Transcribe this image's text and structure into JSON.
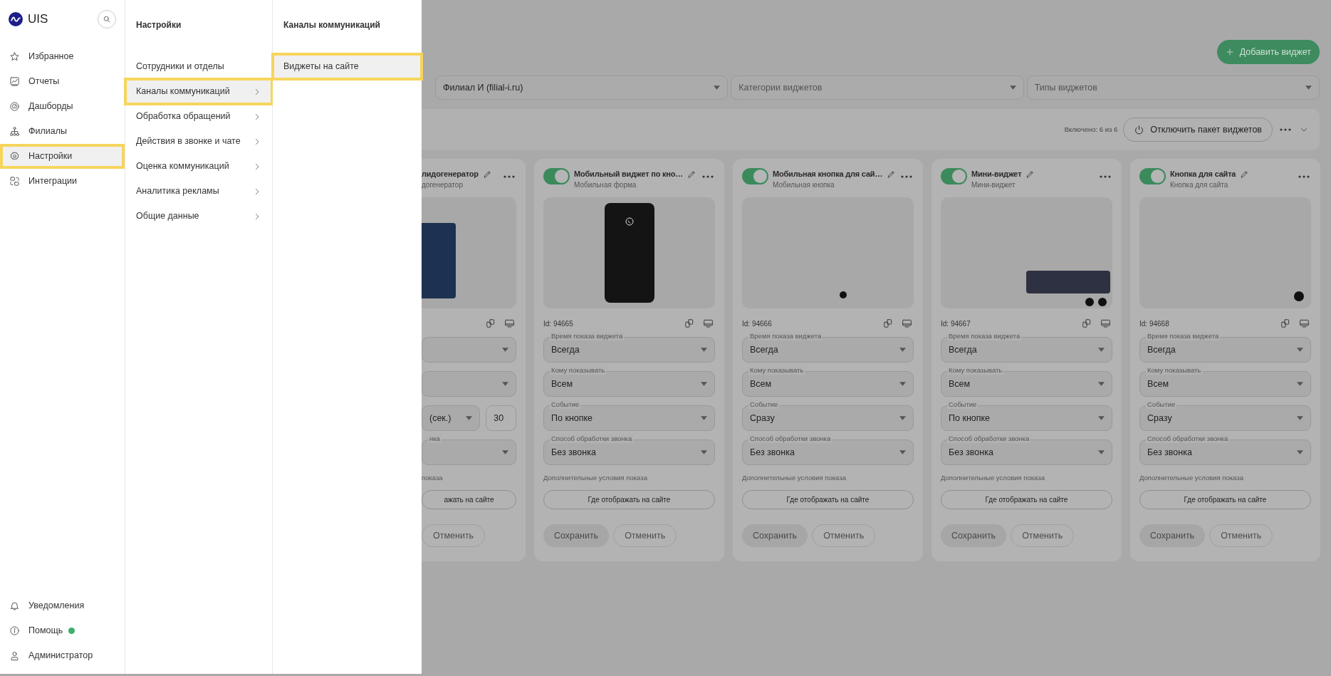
{
  "sidebar": {
    "logo": "UIS",
    "items": [
      {
        "label": "Избранное",
        "selected": false
      },
      {
        "label": "Отчеты",
        "selected": false
      },
      {
        "label": "Дашборды",
        "selected": false
      },
      {
        "label": "Филиалы",
        "selected": false
      },
      {
        "label": "Настройки",
        "selected": true
      },
      {
        "label": "Интеграции",
        "selected": false
      }
    ],
    "bottom_items": [
      {
        "label": "Уведомления",
        "indicator": false
      },
      {
        "label": "Помощь",
        "indicator": true
      },
      {
        "label": "Администратор",
        "indicator": false
      }
    ]
  },
  "settings_menu": {
    "title": "Настройки",
    "items": [
      {
        "label": "Сотрудники и отделы",
        "has_children": false,
        "selected": false
      },
      {
        "label": "Каналы коммуникаций",
        "has_children": true,
        "selected": true
      },
      {
        "label": "Обработка обращений",
        "has_children": true,
        "selected": false
      },
      {
        "label": "Действия в звонке и чате",
        "has_children": true,
        "selected": false
      },
      {
        "label": "Оценка коммуникаций",
        "has_children": true,
        "selected": false
      },
      {
        "label": "Аналитика рекламы",
        "has_children": true,
        "selected": false
      },
      {
        "label": "Общие данные",
        "has_children": true,
        "selected": false
      }
    ]
  },
  "channels_menu": {
    "title": "Каналы коммуникаций",
    "items": [
      {
        "label": "Виджеты на сайте",
        "selected": true
      }
    ]
  },
  "toolbar": {
    "add_button": "Добавить виджет"
  },
  "filters": [
    {
      "value": "Филиал И (filial-i.ru)"
    },
    {
      "placeholder": "Категории виджетов"
    },
    {
      "placeholder": "Типы виджетов"
    }
  ],
  "package": {
    "status": "Включено: 6 из 6",
    "disable_button": "Отключить пакет виджетов"
  },
  "cards": [
    {
      "kind": "partial",
      "title": "лидогенератор",
      "subtitle": "догенератор",
      "preview": {
        "kind": "photo"
      },
      "fields": [
        {
          "kind": "select"
        },
        {
          "kind": "select"
        },
        {
          "kind": "split",
          "value": "(сек.)",
          "input_value": "30"
        },
        {
          "kind": "select",
          "label": "нка"
        }
      ],
      "conditions": "показа",
      "where_button": "ажать на сайте",
      "cancel_button": "Отменить"
    },
    {
      "kind": "full",
      "enabled": true,
      "title": "Мобильный виджет по кно…",
      "subtitle": "Мобильная форма",
      "preview": {
        "kind": "phone"
      },
      "id_text": "Id: 94665",
      "fields": [
        {
          "kind": "select",
          "label": "Время показа виджета",
          "value": "Всегда"
        },
        {
          "kind": "select",
          "label": "Кому показывать",
          "value": "Всем"
        },
        {
          "kind": "select",
          "label": "Событие",
          "value": "По кнопке"
        },
        {
          "kind": "select",
          "label": "Способ обработки звонка",
          "value": "Без звонка"
        }
      ],
      "conditions": "Дополнительные условия показа",
      "where_button": "Где отображать на сайте",
      "save_button": "Сохранить",
      "cancel_button": "Отменить"
    },
    {
      "kind": "full",
      "enabled": true,
      "title": "Мобильная кнопка для сай…",
      "subtitle": "Мобильная кнопка",
      "preview": {
        "kind": "dot"
      },
      "id_text": "Id: 94666",
      "fields": [
        {
          "kind": "select",
          "label": "Время показа виджета",
          "value": "Всегда"
        },
        {
          "kind": "select",
          "label": "Кому показывать",
          "value": "Всем"
        },
        {
          "kind": "select",
          "label": "Событие",
          "value": "Сразу"
        },
        {
          "kind": "select",
          "label": "Способ обработки звонка",
          "value": "Без звонка"
        }
      ],
      "conditions": "Дополнительные условия показа",
      "where_button": "Где отображать на сайте",
      "save_button": "Сохранить",
      "cancel_button": "Отменить"
    },
    {
      "kind": "full",
      "enabled": true,
      "title": "Мини-виджет",
      "subtitle": "Мини-виджет",
      "preview": {
        "kind": "mini"
      },
      "id_text": "Id: 94667",
      "fields": [
        {
          "kind": "select",
          "label": "Время показа виджета",
          "value": "Всегда"
        },
        {
          "kind": "select",
          "label": "Кому показывать",
          "value": "Всем"
        },
        {
          "kind": "select",
          "label": "Событие",
          "value": "По кнопке"
        },
        {
          "kind": "select",
          "label": "Способ обработки звонка",
          "value": "Без звонка"
        }
      ],
      "conditions": "Дополнительные условия показа",
      "where_button": "Где отображать на сайте",
      "save_button": "Сохранить",
      "cancel_button": "Отменить"
    },
    {
      "kind": "full",
      "enabled": true,
      "title": "Кнопка для сайта",
      "subtitle": "Кнопка для сайта",
      "preview": {
        "kind": "button"
      },
      "id_text": "Id: 94668",
      "fields": [
        {
          "kind": "select",
          "label": "Время показа виджета",
          "value": "Всегда"
        },
        {
          "kind": "select",
          "label": "Кому показывать",
          "value": "Всем"
        },
        {
          "kind": "select",
          "label": "Событие",
          "value": "Сразу"
        },
        {
          "kind": "select",
          "label": "Способ обработки звонка",
          "value": "Без звонка"
        }
      ],
      "conditions": "Дополнительные условия показа",
      "where_button": "Где отображать на сайте",
      "save_button": "Сохранить",
      "cancel_button": "Отменить"
    }
  ]
}
